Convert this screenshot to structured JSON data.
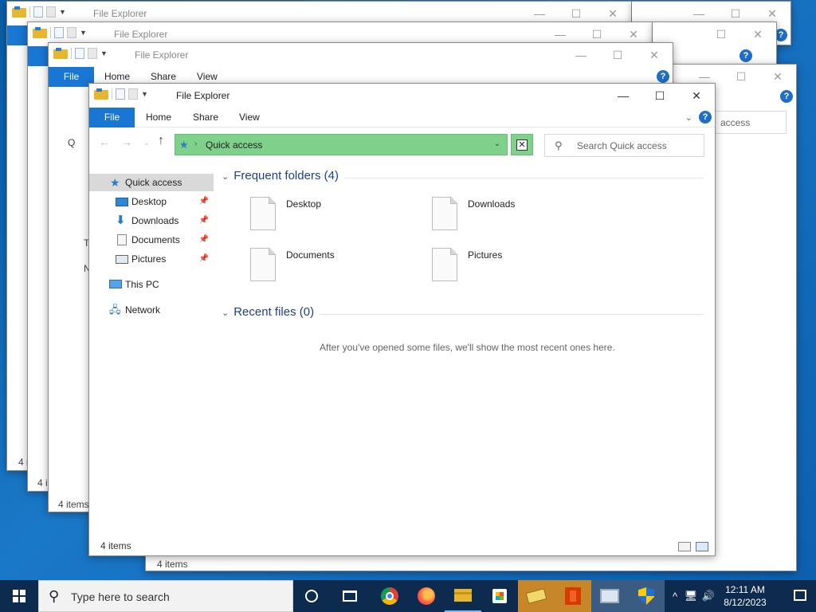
{
  "window": {
    "title": "File Explorer",
    "minimize": "—",
    "maximize": "☐",
    "close": "✕"
  },
  "ribbon": {
    "file": "File",
    "home": "Home",
    "share": "Share",
    "view": "View",
    "help": "?"
  },
  "address": {
    "location": "Quick access",
    "search_placeholder": "Search Quick access"
  },
  "sidebar": {
    "quick_access": "Quick access",
    "items": [
      {
        "label": "Desktop",
        "icon": "desktop-icon"
      },
      {
        "label": "Downloads",
        "icon": "download-icon"
      },
      {
        "label": "Documents",
        "icon": "documents-icon"
      },
      {
        "label": "Pictures",
        "icon": "pictures-icon"
      }
    ],
    "this_pc": "This PC",
    "network": "Network"
  },
  "content": {
    "frequent_header": "Frequent folders (4)",
    "folders": [
      "Desktop",
      "Downloads",
      "Documents",
      "Pictures"
    ],
    "recent_header": "Recent files (0)",
    "recent_empty": "After you've opened some files, we'll show the most recent ones here."
  },
  "status": {
    "count": "4 items"
  },
  "background": {
    "partial_count": "4 i",
    "partial_access": "access",
    "partial_q": "Q",
    "partial_t": "T",
    "partial_n": "N",
    "partial_file": "F",
    "partial_four": "4"
  },
  "taskbar": {
    "search_placeholder": "Type here to search",
    "time": "12:11 AM",
    "date": "8/12/2023"
  },
  "colors": {
    "accent": "#1976d2",
    "address_highlight": "#7fd08a",
    "taskbar": "#0d2a4f"
  }
}
